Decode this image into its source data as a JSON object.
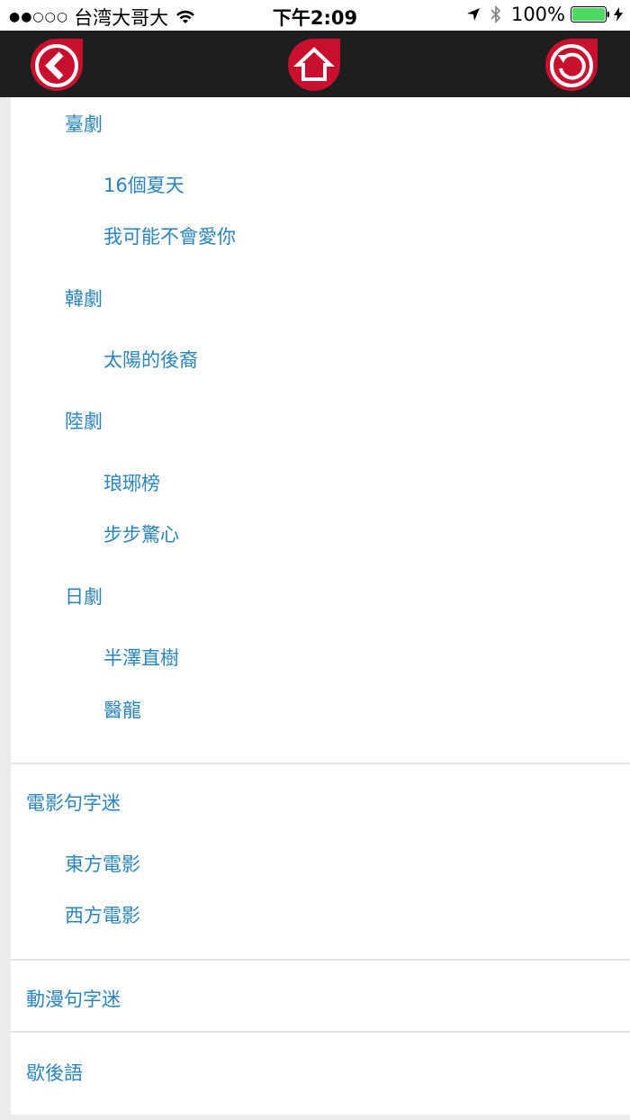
{
  "status": {
    "carrier": "台湾大哥大",
    "time": "下午2:09",
    "battery": "100%",
    "battery_color": "#4cd964"
  },
  "toolbar": {
    "back_icon": "back-arrow-icon",
    "home_icon": "home-icon",
    "refresh_icon": "refresh-icon",
    "accent": "#c8102e"
  },
  "menu": {
    "g1_sub1": "臺劇",
    "g1_sub1_items": [
      "16個夏天",
      "我可能不會愛你"
    ],
    "g1_sub2": "韓劇",
    "g1_sub2_items": [
      "太陽的後裔"
    ],
    "g1_sub3": "陸劇",
    "g1_sub3_items": [
      "琅琊榜",
      "步步驚心"
    ],
    "g1_sub4": "日劇",
    "g1_sub4_items": [
      "半澤直樹",
      "醫龍"
    ],
    "g2": "電影句字迷",
    "g2_items": [
      "東方電影",
      "西方電影"
    ],
    "g3": "動漫句字迷",
    "g4": "歇後語"
  }
}
